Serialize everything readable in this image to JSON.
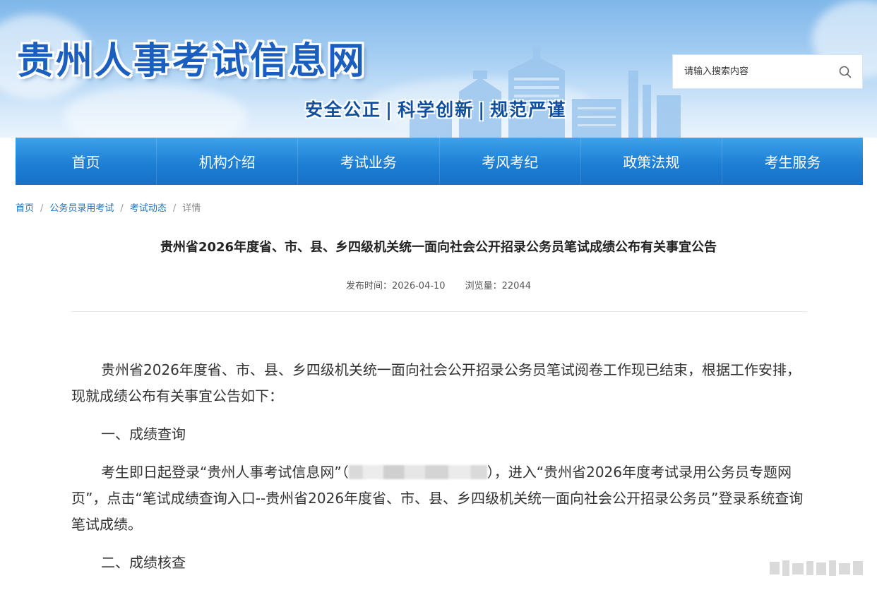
{
  "header": {
    "site_title": "贵州人事考试信息网",
    "slogan": [
      "安全公正",
      "科学创新",
      "规范严谨"
    ],
    "slogan_separator": "|"
  },
  "search": {
    "placeholder": "请输入搜索内容"
  },
  "nav": {
    "items": [
      {
        "label": "首页"
      },
      {
        "label": "机构介绍"
      },
      {
        "label": "考试业务"
      },
      {
        "label": "考风考纪"
      },
      {
        "label": "政策法规"
      },
      {
        "label": "考生服务"
      }
    ]
  },
  "breadcrumb": {
    "items": [
      {
        "label": "首页"
      },
      {
        "label": "公务员录用考试"
      },
      {
        "label": "考试动态"
      },
      {
        "label": "详情"
      }
    ],
    "separator": "/"
  },
  "article": {
    "title": "贵州省2026年度省、市、县、乡四级机关统一面向社会公开招录公务员笔试成绩公布有关事宜公告",
    "publish_label": "发布时间：",
    "publish_date": "2026-04-10",
    "views_label": "浏览量：",
    "views": "22044",
    "paragraphs": {
      "p1": "贵州省2026年度省、市、县、乡四级机关统一面向社会公开招录公务员笔试阅卷工作现已结束，根据工作安排，现就成绩公布有关事宜公告如下：",
      "h1": "一、成绩查询",
      "p2_before": "考生即日起登录“贵州人事考试信息网”（",
      "p2_after": "），进入“贵州省2026年度考试录用公务员专题网页”，点击“笔试成绩查询入口--贵州省2026年度省、市、县、乡四级机关统一面向社会公开招录公务员”登录系统查询笔试成绩。",
      "h2": "二、成绩核查"
    }
  },
  "colors": {
    "nav_bg": "#1e7fd4",
    "title_blue": "#1a5fbf",
    "link_blue": "#1f72c2"
  }
}
